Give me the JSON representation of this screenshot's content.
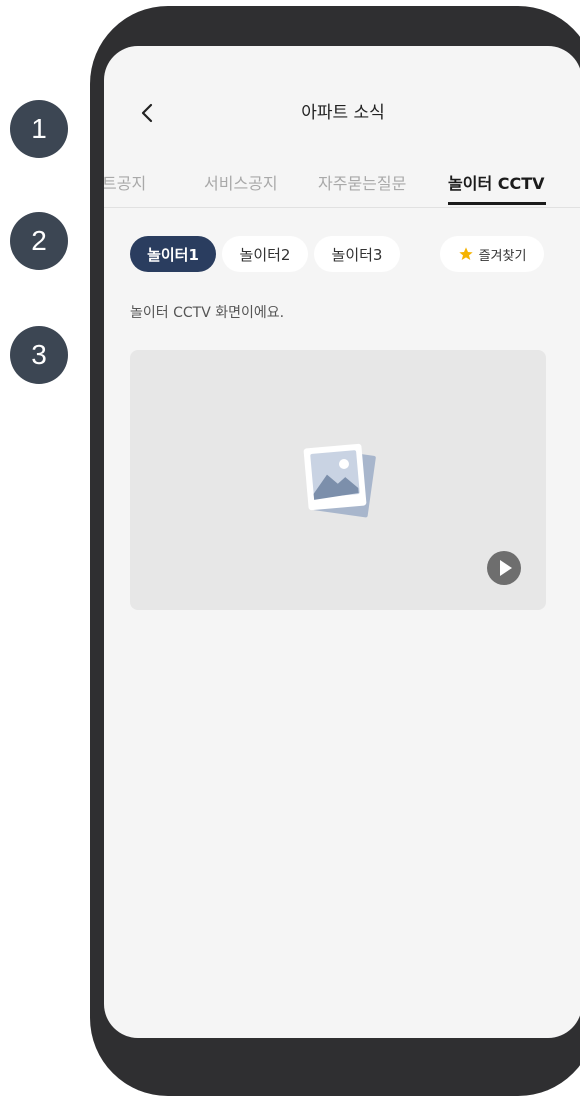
{
  "steps": [
    "1",
    "2",
    "3"
  ],
  "header": {
    "title": "아파트 소식"
  },
  "tabs": [
    {
      "label": "트공지",
      "active": false
    },
    {
      "label": "서비스공지",
      "active": false
    },
    {
      "label": "자주묻는질문",
      "active": false
    },
    {
      "label": "놀이터 CCTV",
      "active": true
    }
  ],
  "chips": [
    {
      "label": "놀이터1",
      "active": true
    },
    {
      "label": "놀이터2",
      "active": false
    },
    {
      "label": "놀이터3",
      "active": false
    }
  ],
  "favorite": {
    "label": "즐겨찾기",
    "icon": "star-icon",
    "icon_color": "#f5b300"
  },
  "description": "놀이터 CCTV 화면이에요.",
  "video": {
    "icon": "image-placeholder-icon",
    "play_icon": "play-icon"
  },
  "colors": {
    "accent": "#2a3d5f",
    "badge": "#3c4653",
    "phone_frame": "#2f2f31"
  }
}
